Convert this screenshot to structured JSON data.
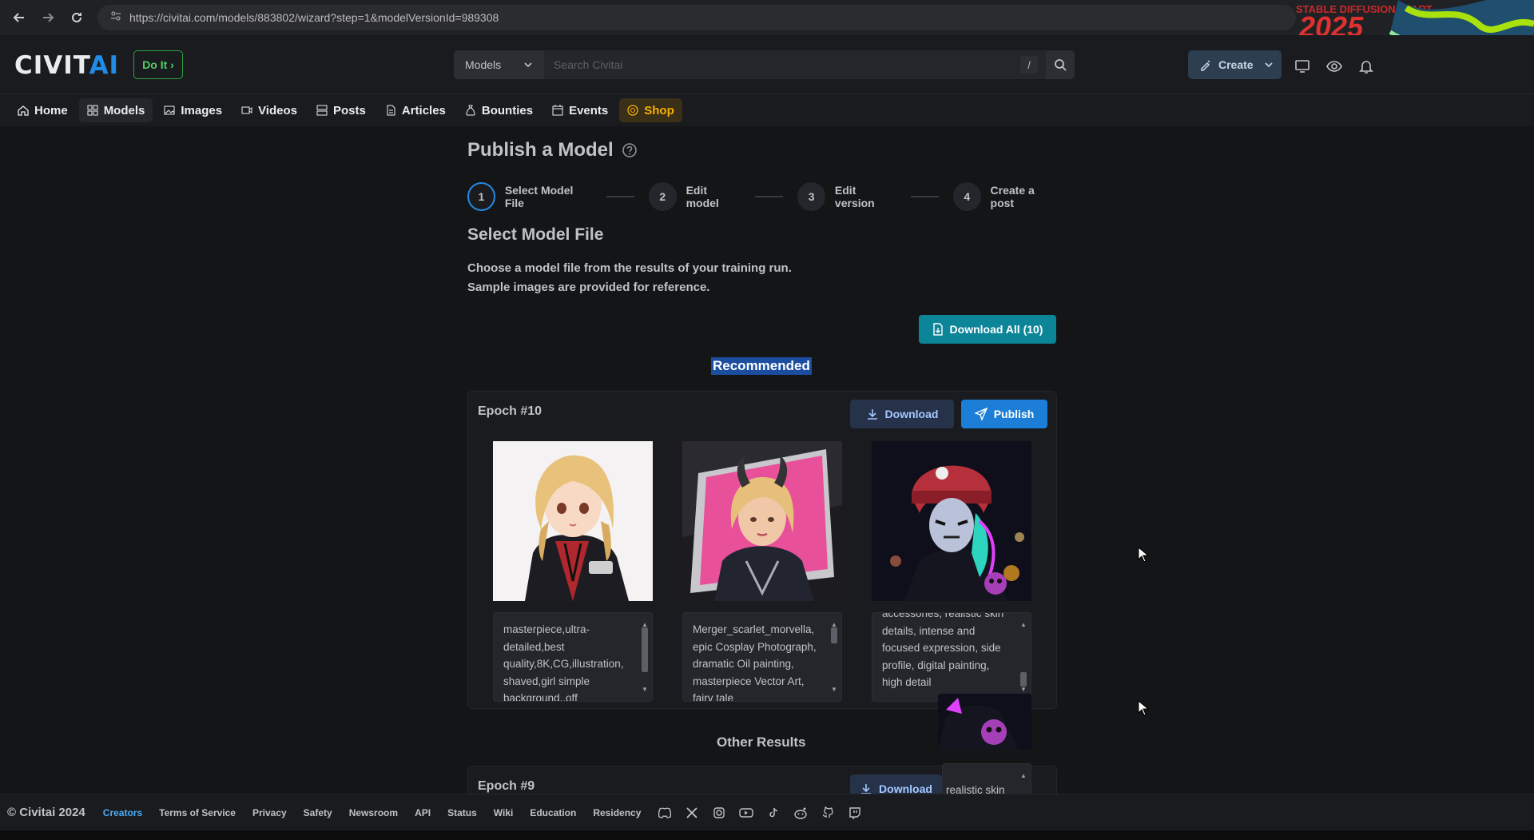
{
  "browser": {
    "url": "https://civitai.com/models/883802/wizard?step=1&modelVersionId=989308"
  },
  "banner": {
    "text": "STABLE DIFFUSION START",
    "year": "2025"
  },
  "header": {
    "logo_civ": "CIVIT",
    "logo_ai": "AI",
    "doit_label": "Do It",
    "search_select": "Models",
    "search_placeholder": "Search Civitai",
    "slash_key": "/",
    "create_label": "Create"
  },
  "nav": {
    "items": [
      {
        "label": "Home",
        "icon": "home-icon"
      },
      {
        "label": "Models",
        "icon": "grid-icon"
      },
      {
        "label": "Images",
        "icon": "image-icon"
      },
      {
        "label": "Videos",
        "icon": "video-icon"
      },
      {
        "label": "Posts",
        "icon": "posts-icon"
      },
      {
        "label": "Articles",
        "icon": "article-icon"
      },
      {
        "label": "Bounties",
        "icon": "moneybag-icon"
      },
      {
        "label": "Events",
        "icon": "calendar-icon"
      },
      {
        "label": "Shop",
        "icon": "shop-icon"
      }
    ]
  },
  "page": {
    "title": "Publish a Model",
    "steps": [
      {
        "num": "1",
        "label": "Select Model File"
      },
      {
        "num": "2",
        "label": "Edit model"
      },
      {
        "num": "3",
        "label": "Edit version"
      },
      {
        "num": "4",
        "label": "Create a post"
      }
    ],
    "section_title": "Select Model File",
    "desc_line1": "Choose a model file from the results of your training run.",
    "desc_line2": "Sample images are provided for reference.",
    "download_all": "Download All (10)",
    "recommended": "Recommended",
    "other_results": "Other Results"
  },
  "epochs": [
    {
      "title": "Epoch #10",
      "download_label": "Download",
      "publish_label": "Publish",
      "prompts": [
        "masterpiece,ultra-detailed,best quality,8K,CG,illustration, shaved,girl simple background,.off",
        "Merger_scarlet_morvella, epic Cosplay Photograph, dramatic Oil painting, masterpiece Vector Art, fairy tale",
        "accessories, realistic skin details, intense and focused expression, side profile, digital painting, high detail"
      ]
    },
    {
      "title": "Epoch #9",
      "download_label": "Download",
      "prompt_partial": "realistic skin\nse and\nression, side\ntal painting,"
    }
  ],
  "footer": {
    "copyright": "© Civitai 2024",
    "links": [
      "Creators",
      "Terms of Service",
      "Privacy",
      "Safety",
      "Newsroom",
      "API",
      "Status",
      "Wiki",
      "Education",
      "Residency"
    ],
    "social_icons": [
      "discord-icon",
      "x-icon",
      "instagram-icon",
      "youtube-icon",
      "tiktok-icon",
      "reddit-icon",
      "github-icon",
      "twitch-icon"
    ]
  },
  "colors": {
    "accent_blue": "#228be6",
    "teal_button": "#0c8599",
    "publish_blue": "#1c7ed6",
    "shop_gold": "#fab005",
    "doit_green": "#51cf66"
  }
}
